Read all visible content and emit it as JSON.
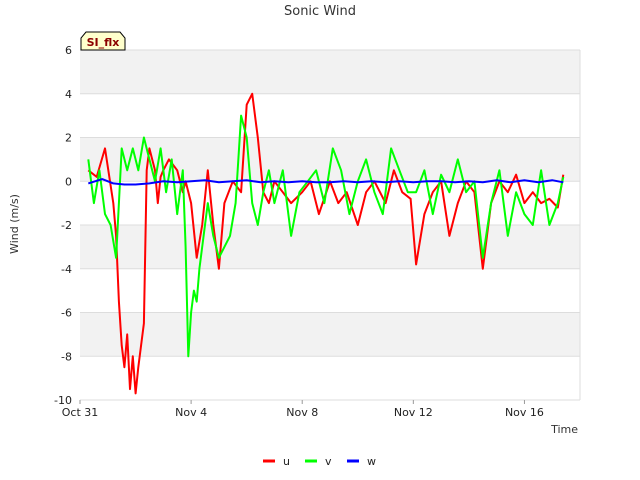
{
  "chart_data": {
    "type": "line",
    "title": "Sonic Wind",
    "badge": "SI_flx",
    "xlabel": "Time",
    "ylabel": "Wind (m/s)",
    "ylim": [
      -10,
      6
    ],
    "yticks": [
      -10,
      -8,
      -6,
      -4,
      -2,
      0,
      2,
      4,
      6
    ],
    "xlim": [
      0,
      18
    ],
    "xticks": [
      {
        "value": 0,
        "label": "Oct 31"
      },
      {
        "value": 4,
        "label": "Nov 4"
      },
      {
        "value": 8,
        "label": "Nov 8"
      },
      {
        "value": 12,
        "label": "Nov 12"
      },
      {
        "value": 16,
        "label": "Nov 16"
      }
    ],
    "grid": true,
    "legend_position": "bottom-center",
    "series": [
      {
        "name": "u",
        "color": "#ff0000",
        "x": [
          0.3,
          0.6,
          0.9,
          1.2,
          1.3,
          1.4,
          1.5,
          1.6,
          1.7,
          1.8,
          1.9,
          2.0,
          2.1,
          2.2,
          2.3,
          2.4,
          2.5,
          2.6,
          2.7,
          2.8,
          2.9,
          3.0,
          3.2,
          3.5,
          3.7,
          3.8,
          4.0,
          4.2,
          4.4,
          4.6,
          4.8,
          5.0,
          5.2,
          5.5,
          5.8,
          6.0,
          6.2,
          6.4,
          6.6,
          6.8,
          7.0,
          7.3,
          7.6,
          8.0,
          8.3,
          8.6,
          9.0,
          9.3,
          9.6,
          10.0,
          10.3,
          10.6,
          11.0,
          11.3,
          11.6,
          11.9,
          12.1,
          12.4,
          12.7,
          13.0,
          13.3,
          13.6,
          13.9,
          14.2,
          14.5,
          14.8,
          15.1,
          15.4,
          15.7,
          16.0,
          16.3,
          16.6,
          16.9,
          17.2,
          17.4
        ],
        "values": [
          0.5,
          0.2,
          1.5,
          -1.0,
          -2.5,
          -5.5,
          -7.5,
          -8.5,
          -7.0,
          -9.5,
          -8.0,
          -9.7,
          -8.5,
          -7.5,
          -6.5,
          0.5,
          1.5,
          1.0,
          0.5,
          -1.0,
          0.2,
          0.5,
          1.0,
          0.5,
          -0.5,
          0.0,
          -1.0,
          -3.5,
          -2.0,
          0.5,
          -2.0,
          -4.0,
          -1.0,
          0.0,
          -0.5,
          3.5,
          4.0,
          2.0,
          -0.5,
          -1.0,
          0.0,
          -0.5,
          -1.0,
          -0.5,
          0.0,
          -1.5,
          0.0,
          -1.0,
          -0.5,
          -2.0,
          -0.5,
          0.0,
          -1.0,
          0.5,
          -0.5,
          -0.8,
          -3.8,
          -1.5,
          -0.5,
          0.0,
          -2.5,
          -1.0,
          0.0,
          -0.5,
          -4.0,
          -1.0,
          0.0,
          -0.5,
          0.3,
          -1.0,
          -0.5,
          -1.0,
          -0.8,
          -1.2,
          0.3
        ]
      },
      {
        "name": "v",
        "color": "#00ff00",
        "x": [
          0.3,
          0.5,
          0.7,
          0.9,
          1.1,
          1.3,
          1.5,
          1.7,
          1.9,
          2.1,
          2.3,
          2.5,
          2.7,
          2.9,
          3.1,
          3.3,
          3.5,
          3.7,
          3.8,
          3.9,
          4.0,
          4.1,
          4.2,
          4.3,
          4.4,
          4.6,
          4.8,
          5.0,
          5.2,
          5.4,
          5.6,
          5.8,
          6.0,
          6.2,
          6.4,
          6.6,
          6.8,
          7.0,
          7.3,
          7.6,
          7.9,
          8.2,
          8.5,
          8.8,
          9.1,
          9.4,
          9.7,
          10.0,
          10.3,
          10.6,
          10.9,
          11.2,
          11.5,
          11.8,
          12.1,
          12.4,
          12.7,
          13.0,
          13.3,
          13.6,
          13.9,
          14.2,
          14.5,
          14.8,
          15.1,
          15.4,
          15.7,
          16.0,
          16.3,
          16.6,
          16.9,
          17.2,
          17.4
        ],
        "values": [
          1.0,
          -1.0,
          0.5,
          -1.5,
          -2.0,
          -3.5,
          1.5,
          0.5,
          1.5,
          0.5,
          2.0,
          1.0,
          0.0,
          1.5,
          -0.5,
          1.0,
          -1.5,
          0.5,
          -3.0,
          -8.0,
          -6.0,
          -5.0,
          -5.5,
          -4.0,
          -3.0,
          -1.0,
          -2.5,
          -3.5,
          -3.0,
          -2.5,
          -1.0,
          3.0,
          2.0,
          -1.0,
          -2.0,
          -0.5,
          0.5,
          -1.0,
          0.5,
          -2.5,
          -0.5,
          0.0,
          0.5,
          -1.0,
          1.5,
          0.5,
          -1.5,
          0.0,
          1.0,
          -0.5,
          -1.5,
          1.5,
          0.5,
          -0.5,
          -0.5,
          0.5,
          -1.5,
          0.3,
          -0.5,
          1.0,
          -0.5,
          0.0,
          -3.5,
          -1.0,
          0.5,
          -2.5,
          -0.5,
          -1.5,
          -2.0,
          0.5,
          -2.0,
          -1.0,
          0.2
        ]
      },
      {
        "name": "w",
        "color": "#0000ff",
        "x": [
          0.3,
          0.8,
          1.2,
          1.6,
          2.0,
          2.5,
          3.0,
          3.5,
          4.0,
          4.5,
          5.0,
          5.5,
          6.0,
          6.5,
          7.0,
          7.5,
          8.0,
          8.5,
          9.0,
          9.5,
          10.0,
          10.5,
          11.0,
          11.5,
          12.0,
          12.5,
          13.0,
          13.5,
          14.0,
          14.5,
          15.0,
          15.5,
          16.0,
          16.5,
          17.0,
          17.4
        ],
        "values": [
          -0.1,
          0.1,
          -0.1,
          -0.15,
          -0.15,
          -0.1,
          0.0,
          -0.05,
          0.0,
          0.05,
          -0.05,
          0.0,
          0.05,
          -0.05,
          0.0,
          -0.05,
          0.0,
          -0.05,
          -0.05,
          0.0,
          -0.05,
          0.0,
          -0.05,
          0.0,
          -0.05,
          0.0,
          0.0,
          -0.05,
          0.0,
          -0.05,
          0.05,
          -0.05,
          0.05,
          -0.05,
          0.05,
          -0.05
        ]
      }
    ]
  }
}
